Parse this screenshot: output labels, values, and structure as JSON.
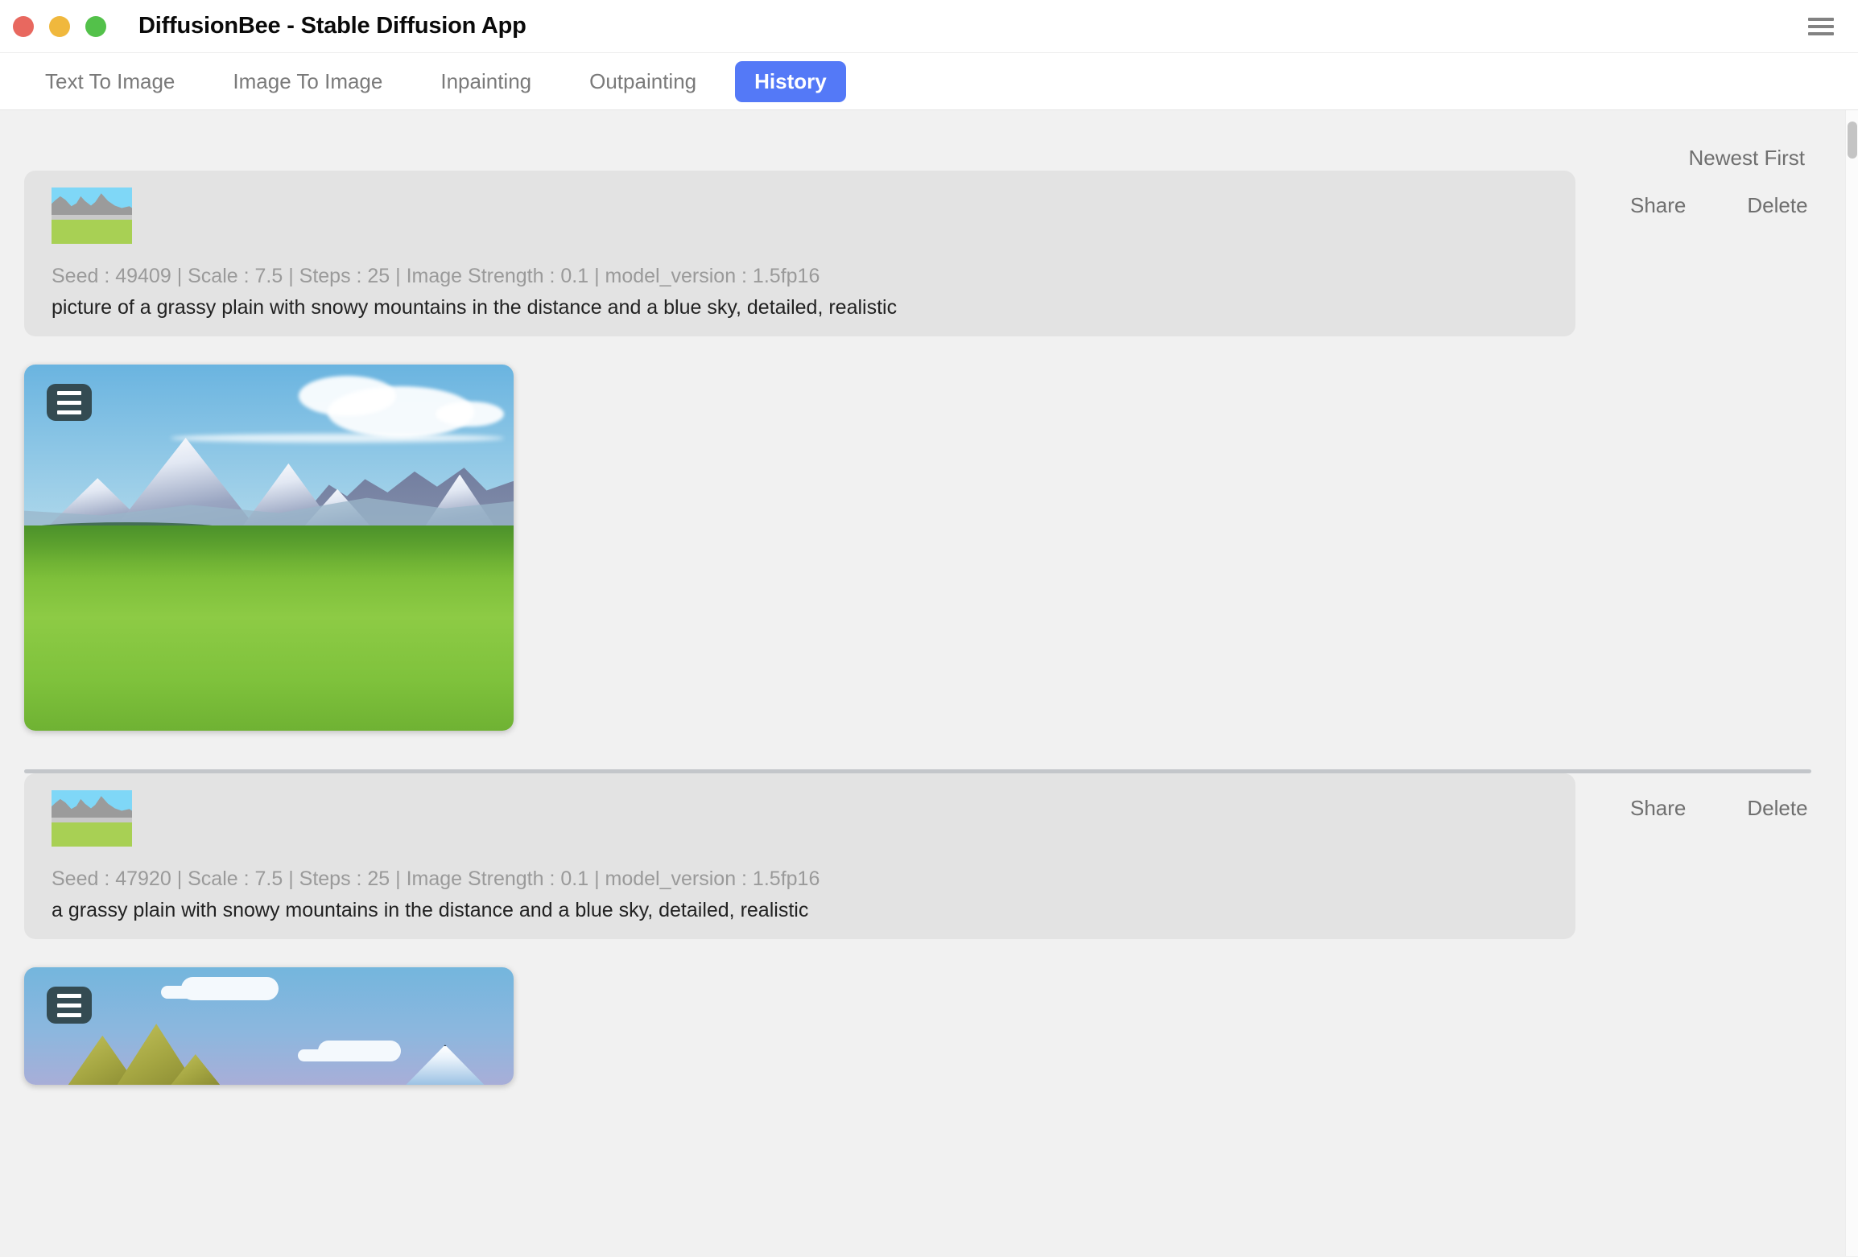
{
  "window": {
    "title": "DiffusionBee - Stable Diffusion App",
    "traffic_lights": [
      {
        "name": "close",
        "color": "#e8685f"
      },
      {
        "name": "minimize",
        "color": "#f0b83d"
      },
      {
        "name": "maximize",
        "color": "#53c14a"
      }
    ],
    "menu_icon": "hamburger-menu-icon"
  },
  "tabs": [
    {
      "label": "Text To Image",
      "active": false
    },
    {
      "label": "Image To Image",
      "active": false
    },
    {
      "label": "Inpainting",
      "active": false
    },
    {
      "label": "Outpainting",
      "active": false
    },
    {
      "label": "History",
      "active": true
    }
  ],
  "accent_color": "#5479f7",
  "sort": {
    "label": "Newest First"
  },
  "actions": {
    "share_label": "Share",
    "delete_label": "Delete"
  },
  "history": [
    {
      "meta": "Seed : 49409 | Scale : 7.5 | Steps : 25 | Image Strength : 0.1 | model_version : 1.5fp16",
      "prompt": "picture of a grassy plain with snowy mountains in the distance and a blue sky, detailed, realistic",
      "seed": "49409",
      "scale": "7.5",
      "steps": "25",
      "image_strength": "0.1",
      "model_version": "1.5fp16",
      "thumbnail": "mountain-plain-thumbnail",
      "generated_image": "grassy-plain-snowy-mountains"
    },
    {
      "meta": "Seed : 47920 | Scale : 7.5 | Steps : 25 | Image Strength : 0.1 | model_version : 1.5fp16",
      "prompt": "a grassy plain with snowy mountains in the distance and a blue sky, detailed, realistic",
      "seed": "47920",
      "scale": "7.5",
      "steps": "25",
      "image_strength": "0.1",
      "model_version": "1.5fp16",
      "thumbnail": "mountain-plain-thumbnail",
      "generated_image": "illustrated-mountains-clouds"
    }
  ]
}
